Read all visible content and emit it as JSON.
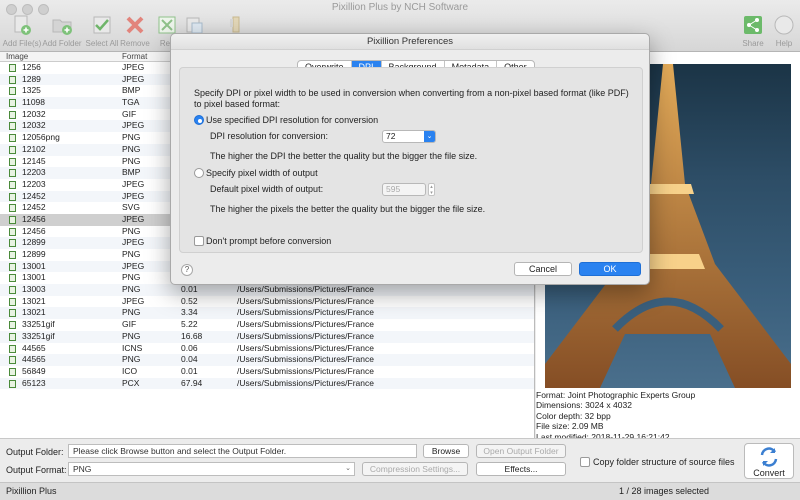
{
  "window": {
    "title": "Pixillion Plus by NCH Software"
  },
  "toolbar": {
    "add_files": "Add File(s)",
    "add_folder": "Add Folder",
    "select_all": "Select All",
    "remove": "Remove",
    "resize": "Res",
    "share": "Share",
    "help": "Help"
  },
  "list": {
    "headers": {
      "image": "Image",
      "format": "Format"
    },
    "rows": [
      {
        "name": "1256",
        "format": "JPEG",
        "size": "",
        "path": ""
      },
      {
        "name": "1289",
        "format": "JPEG",
        "size": "",
        "path": ""
      },
      {
        "name": "1325",
        "format": "BMP",
        "size": "",
        "path": ""
      },
      {
        "name": "11098",
        "format": "TGA",
        "size": "",
        "path": ""
      },
      {
        "name": "12032",
        "format": "GIF",
        "size": "",
        "path": ""
      },
      {
        "name": "12032",
        "format": "JPEG",
        "size": "",
        "path": ""
      },
      {
        "name": "12056png",
        "format": "PNG",
        "size": "",
        "path": ""
      },
      {
        "name": "12102",
        "format": "PNG",
        "size": "",
        "path": ""
      },
      {
        "name": "12145",
        "format": "PNG",
        "size": "",
        "path": ""
      },
      {
        "name": "12203",
        "format": "BMP",
        "size": "",
        "path": ""
      },
      {
        "name": "12203",
        "format": "JPEG",
        "size": "",
        "path": ""
      },
      {
        "name": "12452",
        "format": "JPEG",
        "size": "",
        "path": ""
      },
      {
        "name": "12452",
        "format": "SVG",
        "size": "",
        "path": ""
      },
      {
        "name": "12456",
        "format": "JPEG",
        "size": "",
        "path": ""
      },
      {
        "name": "12456",
        "format": "PNG",
        "size": "",
        "path": ""
      },
      {
        "name": "12899",
        "format": "JPEG",
        "size": "",
        "path": ""
      },
      {
        "name": "12899",
        "format": "PNG",
        "size": "",
        "path": ""
      },
      {
        "name": "13001",
        "format": "JPEG",
        "size": "",
        "path": ""
      },
      {
        "name": "13001",
        "format": "PNG",
        "size": "",
        "path": ""
      },
      {
        "name": "13003",
        "format": "PNG",
        "size": "0.01",
        "path": "/Users/Submissions/Pictures/France"
      },
      {
        "name": "13021",
        "format": "JPEG",
        "size": "0.52",
        "path": "/Users/Submissions/Pictures/France"
      },
      {
        "name": "13021",
        "format": "PNG",
        "size": "3.34",
        "path": "/Users/Submissions/Pictures/France"
      },
      {
        "name": "33251gif",
        "format": "GIF",
        "size": "5.22",
        "path": "/Users/Submissions/Pictures/France"
      },
      {
        "name": "33251gif",
        "format": "PNG",
        "size": "16.68",
        "path": "/Users/Submissions/Pictures/France"
      },
      {
        "name": "44565",
        "format": "ICNS",
        "size": "0.06",
        "path": "/Users/Submissions/Pictures/France"
      },
      {
        "name": "44565",
        "format": "PNG",
        "size": "0.04",
        "path": "/Users/Submissions/Pictures/France"
      },
      {
        "name": "56849",
        "format": "ICO",
        "size": "0.01",
        "path": "/Users/Submissions/Pictures/France"
      },
      {
        "name": "65123",
        "format": "PCX",
        "size": "67.94",
        "path": "/Users/Submissions/Pictures/France"
      }
    ]
  },
  "preview": {
    "format": "Format: Joint Photographic Experts Group",
    "dimensions": "Dimensions: 3024 x 4032",
    "depth": "Color depth: 32 bpp",
    "filesize": "File size: 2.09 MB",
    "modified": "Last modified: 2018-11-29 16:21:42"
  },
  "bottom": {
    "output_folder_label": "Output Folder:",
    "output_folder_value": "Please click Browse button and select the Output Folder.",
    "browse": "Browse",
    "open_output_folder": "Open Output Folder",
    "output_format_label": "Output Format:",
    "output_format_value": "PNG",
    "compression_settings": "Compression Settings...",
    "effects": "Effects...",
    "copy_structure": "Copy folder structure of source files",
    "convert": "Convert"
  },
  "status": {
    "app": "Pixillion Plus",
    "selection": "1 / 28 images selected"
  },
  "dialog": {
    "title": "Pixillion Preferences",
    "tabs": [
      "Overwrite",
      "DPI",
      "Background",
      "Metadata",
      "Other"
    ],
    "active_tab": "DPI",
    "intro": "Specify DPI or pixel width to be used in conversion when converting from a non-pixel based format (like PDF) to pixel based format:",
    "opt_dpi": "Use specified DPI resolution for conversion",
    "dpi_label": "DPI resolution for conversion:",
    "dpi_value": "72",
    "dpi_note": "The higher the DPI the better the quality but the bigger the file size.",
    "opt_pixel": "Specify pixel width of output",
    "pixel_label": "Default pixel width of output:",
    "pixel_value": "595",
    "pixel_note": "The higher the pixels the better the quality but the bigger the file size.",
    "dont_prompt": "Don't prompt before conversion",
    "help": "?",
    "cancel": "Cancel",
    "ok": "OK"
  }
}
